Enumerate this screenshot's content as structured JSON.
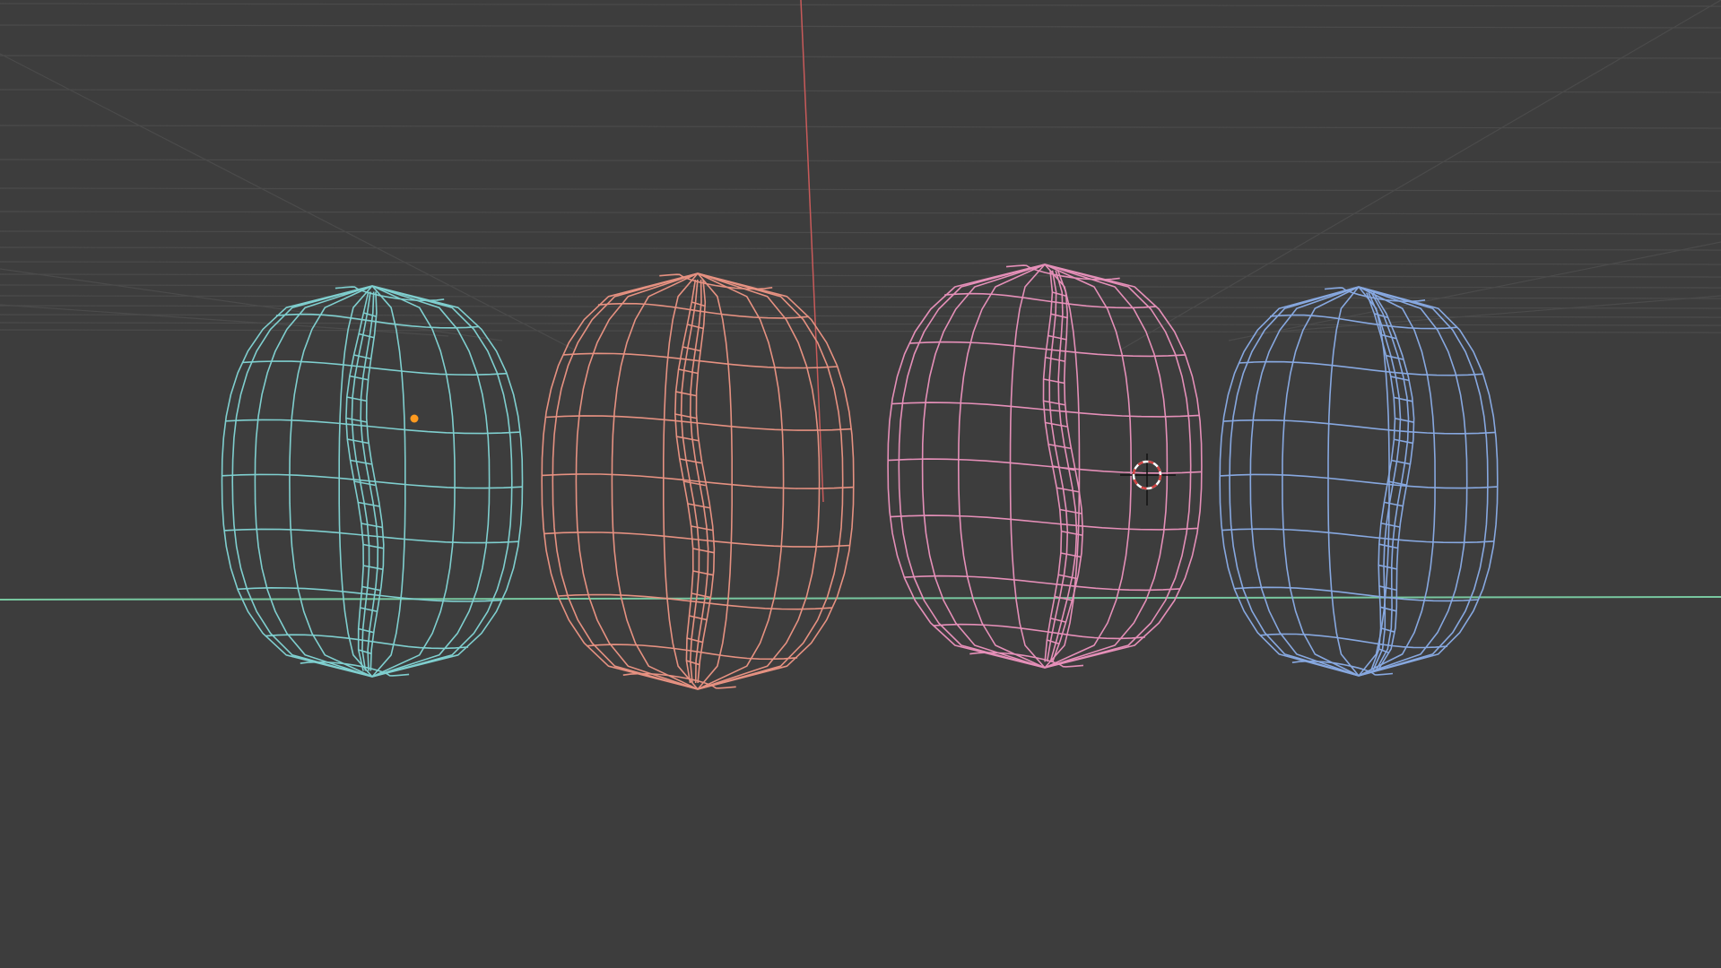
{
  "viewport": {
    "background_color": "#3d3d3d",
    "grid_color": "#4b4b4b",
    "x_axis_color": "#c85a5a",
    "y_axis_color": "#78c8a0",
    "icons": {
      "origin": "object-origin-dot-icon",
      "cursor": "3d-cursor-icon"
    },
    "origin_color": "#ff9a1f",
    "cursor_colors": {
      "ring_light": "#ffffff",
      "ring_dark": "#d04040",
      "crosshair": "#111111"
    }
  },
  "objects": [
    {
      "color": "#7fcfcf",
      "selected": true
    },
    {
      "color": "#e69181"
    },
    {
      "color": "#e58fb8"
    },
    {
      "color": "#87a8e0"
    }
  ]
}
